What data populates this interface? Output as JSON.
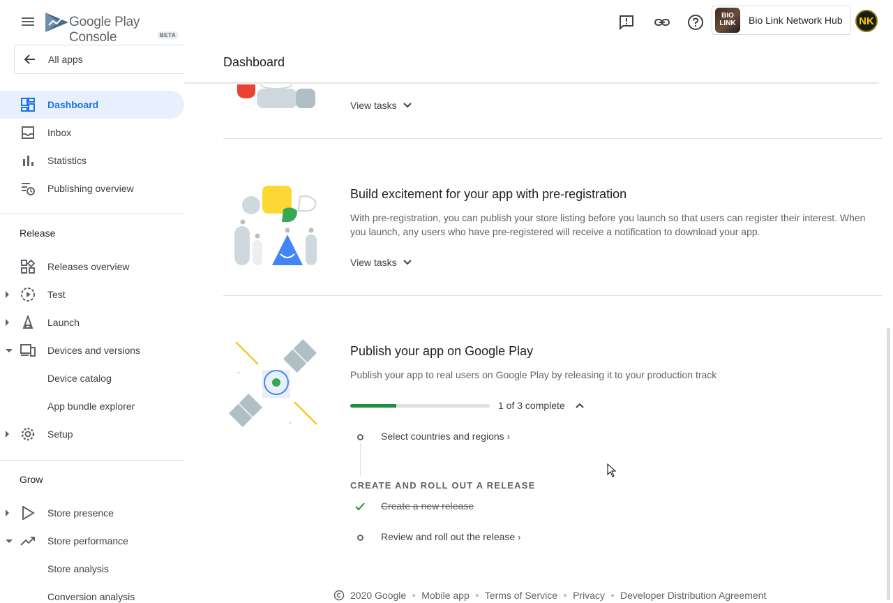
{
  "header": {
    "logo_main": "Google Play",
    "logo_sub": "Console",
    "beta": "BETA",
    "page_title": "Dashboard",
    "account_app_icon_text": "BIO LINK",
    "account_name": "Bio Link Network Hub",
    "avatar_initials": "NK",
    "icons": [
      "feedback-icon",
      "link-icon",
      "help-icon"
    ]
  },
  "sidebar": {
    "all_apps": "All apps",
    "items_top": [
      {
        "label": "Dashboard",
        "icon": "dashboard-icon",
        "active": true
      },
      {
        "label": "Inbox",
        "icon": "inbox-icon"
      },
      {
        "label": "Statistics",
        "icon": "bar-chart-icon"
      },
      {
        "label": "Publishing overview",
        "icon": "publishing-icon"
      }
    ],
    "release_heading": "Release",
    "release_items": [
      {
        "label": "Releases overview",
        "icon": "releases-icon"
      },
      {
        "label": "Test",
        "icon": "test-icon",
        "expand": "collapsed"
      },
      {
        "label": "Launch",
        "icon": "launch-icon",
        "expand": "collapsed"
      },
      {
        "label": "Devices and versions",
        "icon": "devices-icon",
        "expand": "expanded"
      },
      {
        "label": "Device catalog",
        "sub": true
      },
      {
        "label": "App bundle explorer",
        "sub": true
      },
      {
        "label": "Setup",
        "icon": "gear-icon",
        "expand": "collapsed"
      }
    ],
    "grow_heading": "Grow",
    "grow_items": [
      {
        "label": "Store presence",
        "icon": "store-presence-icon",
        "expand": "collapsed"
      },
      {
        "label": "Store performance",
        "icon": "trending-icon",
        "expand": "expanded"
      },
      {
        "label": "Store analysis",
        "sub": true
      },
      {
        "label": "Conversion analysis",
        "sub": true
      }
    ]
  },
  "main": {
    "view_tasks": "View tasks",
    "preregistration": {
      "title": "Build excitement for your app with pre-registration",
      "description": "With pre-registration, you can publish your store listing before you launch so that users can register their interest. When you launch, any users who have pre-registered will receive a notification to download your app.",
      "view_tasks": "View tasks"
    },
    "publish": {
      "title": "Publish your app on Google Play",
      "description": "Publish your app to real users on Google Play by releasing it to your production track",
      "progress_label": "1 of 3 complete",
      "progress_fraction": 0.33,
      "step_countries": "Select countries and regions",
      "subheading": "CREATE AND ROLL OUT A RELEASE",
      "step_create": "Create a new release",
      "step_review": "Review and roll out the release"
    }
  },
  "footer": {
    "copyright": "2020 Google",
    "links": [
      "Mobile app",
      "Terms of Service",
      "Privacy",
      "Developer Distribution Agreement"
    ]
  },
  "colors": {
    "accent": "#1a73e8",
    "active_bg": "#e8f0fe",
    "progress": "#1e8e3e",
    "text_secondary": "#5f6368"
  }
}
